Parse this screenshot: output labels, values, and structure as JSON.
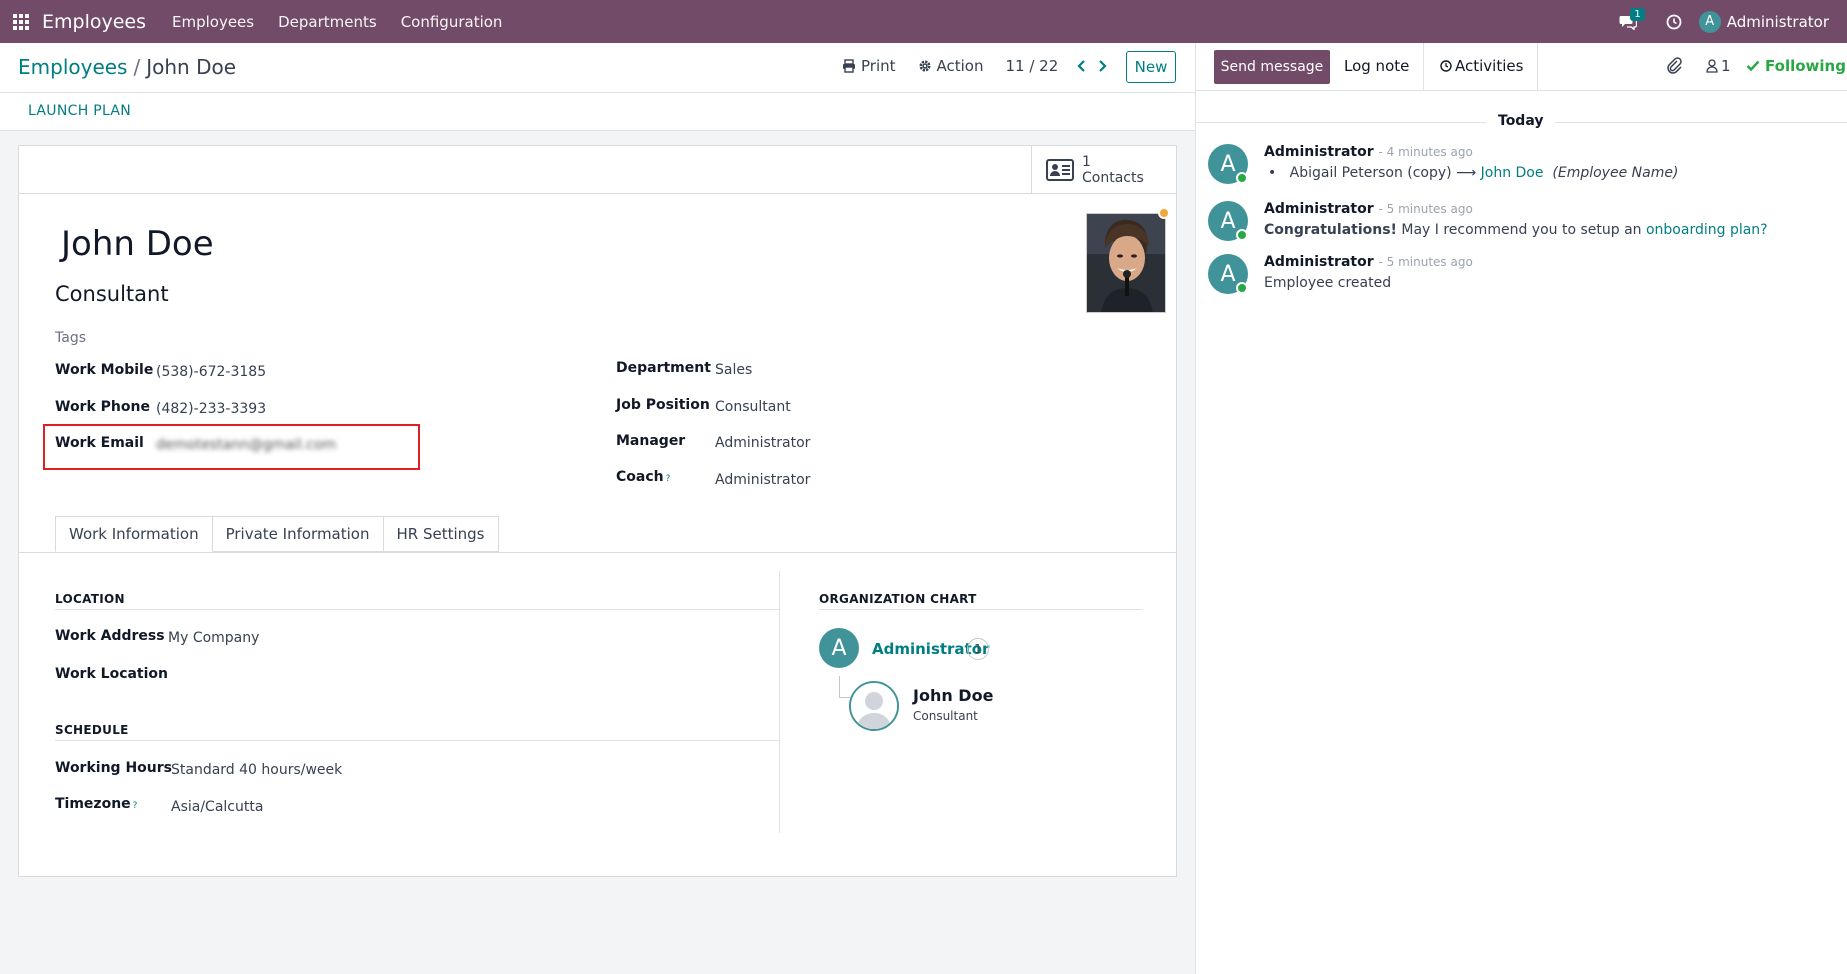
{
  "navbar": {
    "app_name": "Employees",
    "menu": [
      "Employees",
      "Departments",
      "Configuration"
    ],
    "chat_badge": "1",
    "user_initial": "A",
    "user_name": "Administrator"
  },
  "control_panel": {
    "breadcrumb_parent": "Employees",
    "breadcrumb_sep": "/",
    "breadcrumb_current": "John Doe",
    "print_label": "Print",
    "action_label": "Action",
    "pager": "11 / 22",
    "new_label": "New"
  },
  "statusbar": {
    "launch_plan_label": "LAUNCH PLAN"
  },
  "button_box": {
    "contacts_count": "1",
    "contacts_label": "Contacts"
  },
  "employee": {
    "name": "John Doe",
    "job_title": "Consultant",
    "tags_placeholder": "Tags",
    "work_mobile_label": "Work Mobile",
    "work_mobile": "(538)-672-3185",
    "work_phone_label": "Work Phone",
    "work_phone": "(482)-233-3393",
    "work_email_label": "Work Email",
    "work_email": "demotestann@gmail.com",
    "department_label": "Department",
    "department": "Sales",
    "job_position_label": "Job Position",
    "job_position": "Consultant",
    "manager_label": "Manager",
    "manager": "Administrator",
    "coach_label": "Coach",
    "coach": "Administrator",
    "help_mark": "?"
  },
  "tabs": [
    "Work Information",
    "Private Information",
    "HR Settings"
  ],
  "work_info": {
    "location_title": "LOCATION",
    "work_address_label": "Work Address",
    "work_address": "My Company",
    "work_location_label": "Work Location",
    "schedule_title": "SCHEDULE",
    "working_hours_label": "Working Hours",
    "working_hours": "Standard 40 hours/week",
    "timezone_label": "Timezone",
    "timezone": "Asia/Calcutta"
  },
  "org_chart": {
    "title": "ORGANIZATION CHART",
    "manager_initial": "A",
    "manager_name": "Administrator",
    "manager_count": "1",
    "employee_name": "John Doe",
    "employee_job": "Consultant"
  },
  "chatter": {
    "send_message_label": "Send message",
    "log_note_label": "Log note",
    "activities_label": "Activities",
    "followers_count": "1",
    "following_label": "Following",
    "date_separator": "Today",
    "messages": [
      {
        "initial": "A",
        "author": "Administrator",
        "time": "- 4 minutes ago",
        "old_value": "Abigail Peterson (copy)",
        "arrow": "⟶",
        "new_value": "John Doe",
        "field_name": "(Employee Name)"
      },
      {
        "initial": "A",
        "author": "Administrator",
        "time": "- 5 minutes ago",
        "bold_text": "Congratulations!",
        "text": " May I recommend you to setup an ",
        "link_text": "onboarding plan?"
      },
      {
        "initial": "A",
        "author": "Administrator",
        "time": "- 5 minutes ago",
        "text": "Employee created"
      }
    ]
  },
  "colors": {
    "brand": "#714b67",
    "accent": "#017e84",
    "avatar": "#41939a",
    "highlight": "#e02020",
    "following": "#28a745"
  }
}
